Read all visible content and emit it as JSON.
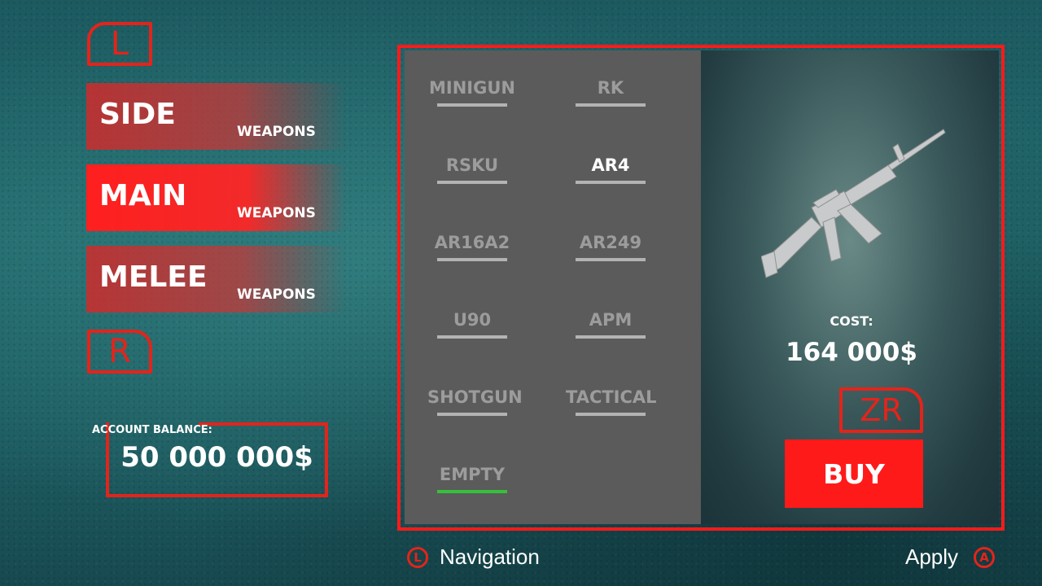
{
  "controls": {
    "prev_category_button": "L",
    "next_category_button": "R",
    "buy_shortcut_button": "ZR"
  },
  "categories": [
    {
      "label": "SIDE",
      "sublabel": "WEAPONS",
      "active": false
    },
    {
      "label": "MAIN",
      "sublabel": "WEAPONS",
      "active": true
    },
    {
      "label": "MELEE",
      "sublabel": "WEAPONS",
      "active": false
    }
  ],
  "account": {
    "label": "ACCOUNT BALANCE:",
    "value": "50 000 000$"
  },
  "weapons": [
    {
      "name": "MINIGUN",
      "state": "available"
    },
    {
      "name": "RK",
      "state": "available"
    },
    {
      "name": "RSKU",
      "state": "available"
    },
    {
      "name": "AR4",
      "state": "selected"
    },
    {
      "name": "AR16A2",
      "state": "available"
    },
    {
      "name": "AR249",
      "state": "available"
    },
    {
      "name": "U90",
      "state": "available"
    },
    {
      "name": "APM",
      "state": "available"
    },
    {
      "name": "SHOTGUN",
      "state": "available"
    },
    {
      "name": "TACTICAL",
      "state": "available"
    },
    {
      "name": "EMPTY",
      "state": "equipped"
    }
  ],
  "detail": {
    "image_icon": "assault-rifle-icon",
    "cost_label": "COST:",
    "cost_value": "164 000$",
    "buy_label": "BUY"
  },
  "footer": {
    "navigation_button": "L",
    "navigation_label": "Navigation",
    "apply_label": "Apply",
    "apply_button": "A"
  },
  "colors": {
    "accent_red": "#ff1a1a",
    "panel_gray": "#5b5b5b",
    "equipped_green": "#36c13a",
    "background_teal": "#1f6266"
  }
}
